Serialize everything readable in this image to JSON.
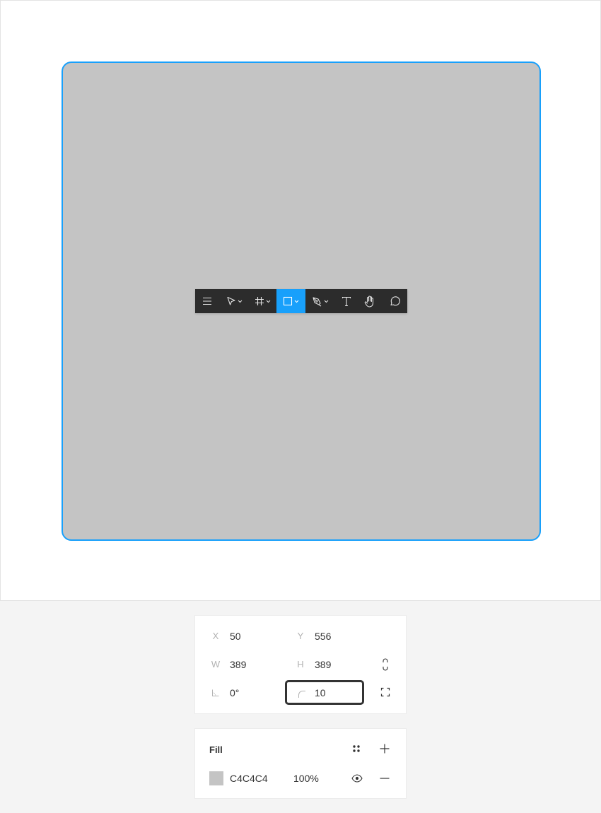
{
  "canvas": {
    "shape_fill": "#c4c4c4",
    "selection_color": "#18a0fb"
  },
  "toolbar": {
    "tools": [
      {
        "name": "main-menu",
        "icon": "hamburger-icon"
      },
      {
        "name": "move-tool",
        "icon": "cursor-arrow-icon",
        "has_dropdown": true
      },
      {
        "name": "frame-tool",
        "icon": "hash-frame-icon",
        "has_dropdown": true
      },
      {
        "name": "rectangle-tool",
        "icon": "square-icon",
        "has_dropdown": true,
        "active": true
      },
      {
        "name": "pen-tool",
        "icon": "pen-nib-icon",
        "has_dropdown": true
      },
      {
        "name": "text-tool",
        "icon": "text-t-icon"
      },
      {
        "name": "hand-tool",
        "icon": "hand-icon"
      },
      {
        "name": "comment-tool",
        "icon": "speech-bubble-icon"
      }
    ],
    "active_color": "#18a0fb"
  },
  "properties": {
    "x_label": "X",
    "x_value": "50",
    "y_label": "Y",
    "y_value": "556",
    "w_label": "W",
    "w_value": "389",
    "h_label": "H",
    "h_value": "389",
    "rotation_value": "0°",
    "corner_radius_value": "10",
    "constrain_icon": "link-proportions-icon",
    "independent_corners_icon": "independent-corners-icon",
    "rotation_icon": "angle-icon",
    "radius_icon": "corner-radius-icon"
  },
  "fill": {
    "title": "Fill",
    "color_hex": "C4C4C4",
    "color_swatch": "#c4c4c4",
    "opacity": "100%",
    "style_icon": "four-dots-style-icon",
    "add_icon": "plus-icon",
    "visibility_icon": "eye-icon",
    "remove_icon": "minus-icon"
  }
}
